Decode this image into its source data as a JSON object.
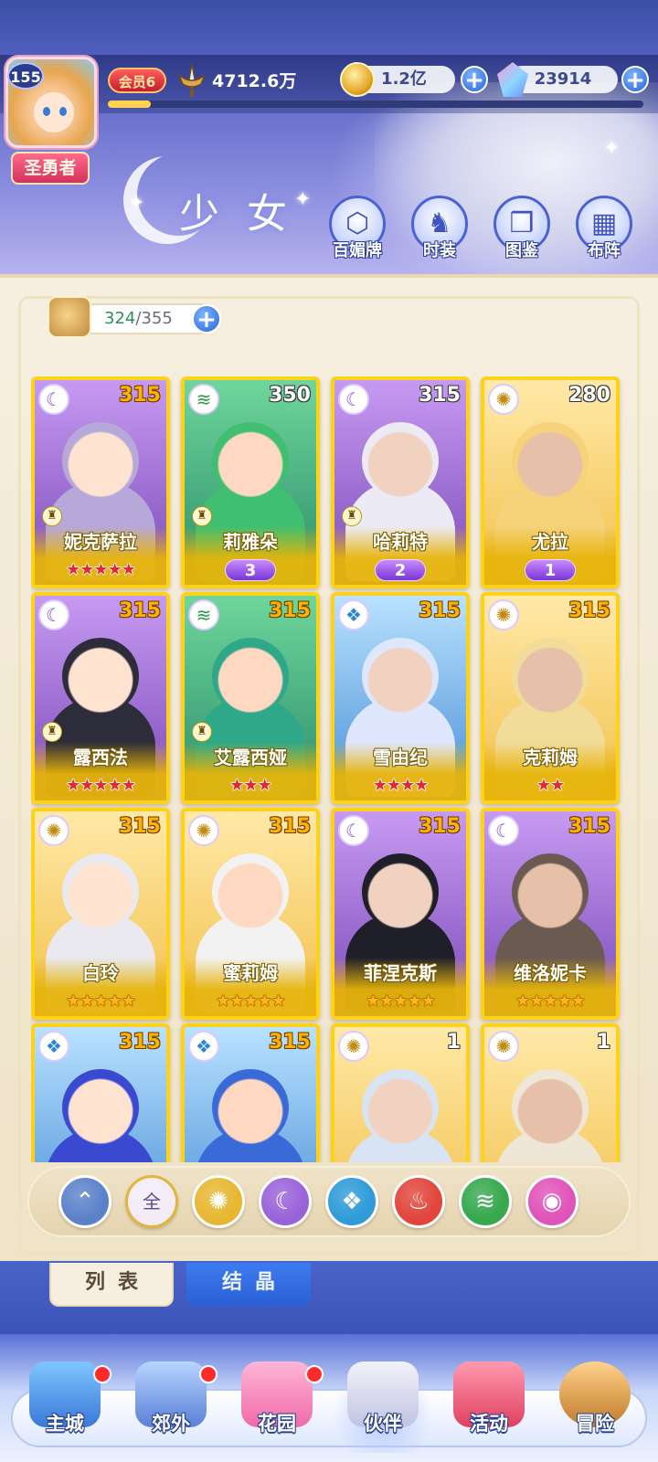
{
  "header": {
    "player_level": "155",
    "player_title": "圣勇者",
    "vip_label": "会员6",
    "power": "4712.6万",
    "xp_progress": 0.08,
    "gold": "1.2亿",
    "gems": "23914",
    "section_title": "少女",
    "menu": [
      {
        "label": "百媚牌",
        "icon": "card-icon"
      },
      {
        "label": "时装",
        "icon": "outfit-icon"
      },
      {
        "label": "图鉴",
        "icon": "book-icon"
      },
      {
        "label": "布阵",
        "icon": "grid-icon"
      }
    ]
  },
  "collection": {
    "owned": "324",
    "separator": "/",
    "capacity": "355"
  },
  "cards": [
    {
      "name": "妮克萨拉",
      "level": "315",
      "element": "moon",
      "stars": 5,
      "star_color": "red",
      "badge": ""
    },
    {
      "name": "莉雅朵",
      "level": "350",
      "element": "wind",
      "stars": 0,
      "star_color": "",
      "badge": "3"
    },
    {
      "name": "哈莉特",
      "level": "315",
      "element": "moon",
      "stars": 0,
      "star_color": "",
      "badge": "2"
    },
    {
      "name": "尤拉",
      "level": "280",
      "element": "sun",
      "stars": 0,
      "star_color": "",
      "badge": "1"
    },
    {
      "name": "露西法",
      "level": "315",
      "element": "moon",
      "stars": 5,
      "star_color": "red",
      "badge": ""
    },
    {
      "name": "艾露西娅",
      "level": "315",
      "element": "wind",
      "stars": 3,
      "star_color": "red",
      "badge": ""
    },
    {
      "name": "雪由纪",
      "level": "315",
      "element": "water",
      "stars": 4,
      "star_color": "red",
      "badge": ""
    },
    {
      "name": "克莉姆",
      "level": "315",
      "element": "sun",
      "stars": 2,
      "star_color": "red",
      "badge": ""
    },
    {
      "name": "白玲",
      "level": "315",
      "element": "sun",
      "stars": 5,
      "star_color": "gold",
      "badge": ""
    },
    {
      "name": "蜜莉姆",
      "level": "315",
      "element": "sun",
      "stars": 5,
      "star_color": "gold",
      "badge": ""
    },
    {
      "name": "菲涅克斯",
      "level": "315",
      "element": "moon",
      "stars": 5,
      "star_color": "gold",
      "badge": ""
    },
    {
      "name": "维洛妮卡",
      "level": "315",
      "element": "moon",
      "stars": 5,
      "star_color": "gold",
      "badge": ""
    },
    {
      "name": "",
      "level": "315",
      "element": "water",
      "stars": 0,
      "star_color": "",
      "badge": ""
    },
    {
      "name": "",
      "level": "315",
      "element": "water",
      "stars": 0,
      "star_color": "",
      "badge": ""
    },
    {
      "name": "",
      "level": "1",
      "element": "sun",
      "stars": 0,
      "star_color": "",
      "badge": ""
    },
    {
      "name": "",
      "level": "1",
      "element": "sun",
      "stars": 0,
      "star_color": "",
      "badge": ""
    }
  ],
  "filters": [
    {
      "label": "",
      "icon": "sort-icon",
      "color": "#5b82c9"
    },
    {
      "label": "全",
      "icon": "all-icon",
      "color": "#f3ecf8"
    },
    {
      "label": "",
      "icon": "sun-icon",
      "color": "#e7b731"
    },
    {
      "label": "",
      "icon": "moon-icon",
      "color": "#9a62d9"
    },
    {
      "label": "",
      "icon": "water-icon",
      "color": "#2f9bd8"
    },
    {
      "label": "",
      "icon": "fire-icon",
      "color": "#e1453b"
    },
    {
      "label": "",
      "icon": "wind-icon",
      "color": "#36a84e"
    },
    {
      "label": "",
      "icon": "heart-icon",
      "color": "#e053b8"
    }
  ],
  "tabs": {
    "list": "列表",
    "crystal": "结晶"
  },
  "nav": [
    {
      "label": "主城",
      "has_dot": true
    },
    {
      "label": "郊外",
      "has_dot": true
    },
    {
      "label": "花园",
      "has_dot": true
    },
    {
      "label": "伙伴",
      "has_dot": false,
      "active": true
    },
    {
      "label": "活动",
      "has_dot": false
    },
    {
      "label": "冒险",
      "has_dot": false
    }
  ]
}
